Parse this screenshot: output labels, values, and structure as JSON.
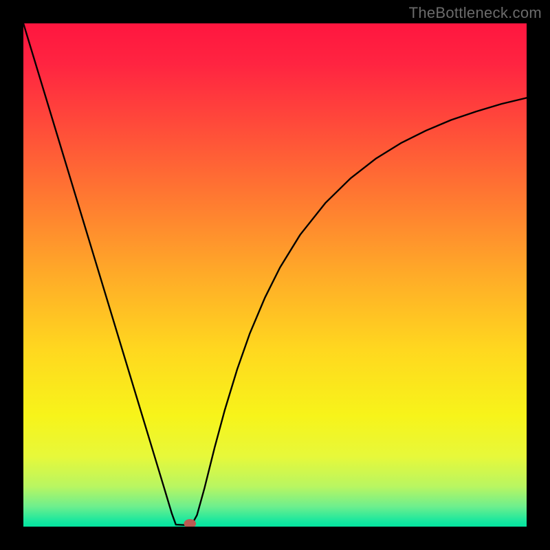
{
  "watermark": "TheBottleneck.com",
  "chart_data": {
    "type": "line",
    "title": "",
    "xlabel": "",
    "ylabel": "",
    "xlim": [
      0,
      100
    ],
    "ylim": [
      0,
      100
    ],
    "grid": false,
    "legend": false,
    "background": {
      "type": "vertical-gradient",
      "stops": [
        {
          "offset": 0.0,
          "color": "#ff163f"
        },
        {
          "offset": 0.08,
          "color": "#ff2441"
        },
        {
          "offset": 0.2,
          "color": "#ff4a3a"
        },
        {
          "offset": 0.35,
          "color": "#ff7a31"
        },
        {
          "offset": 0.5,
          "color": "#ffab28"
        },
        {
          "offset": 0.65,
          "color": "#ffd81f"
        },
        {
          "offset": 0.78,
          "color": "#f7f41a"
        },
        {
          "offset": 0.86,
          "color": "#e7f83a"
        },
        {
          "offset": 0.92,
          "color": "#b9f661"
        },
        {
          "offset": 0.96,
          "color": "#6eef8d"
        },
        {
          "offset": 0.99,
          "color": "#15e79f"
        },
        {
          "offset": 1.0,
          "color": "#04e39f"
        }
      ]
    },
    "series": [
      {
        "name": "left-branch",
        "stroke": "#000000",
        "points": [
          {
            "x": 0.0,
            "y": 100.0
          },
          {
            "x": 2.0,
            "y": 93.4
          },
          {
            "x": 5.0,
            "y": 83.5
          },
          {
            "x": 8.0,
            "y": 73.6
          },
          {
            "x": 11.0,
            "y": 63.7
          },
          {
            "x": 14.0,
            "y": 53.8
          },
          {
            "x": 17.0,
            "y": 43.9
          },
          {
            "x": 20.0,
            "y": 34.0
          },
          {
            "x": 23.0,
            "y": 24.1
          },
          {
            "x": 26.0,
            "y": 14.2
          },
          {
            "x": 28.0,
            "y": 7.6
          },
          {
            "x": 29.5,
            "y": 2.6
          },
          {
            "x": 30.3,
            "y": 0.4
          }
        ]
      },
      {
        "name": "valley-floor",
        "stroke": "#000000",
        "points": [
          {
            "x": 30.3,
            "y": 0.4
          },
          {
            "x": 32.4,
            "y": 0.3
          },
          {
            "x": 33.4,
            "y": 0.3
          }
        ]
      },
      {
        "name": "right-branch",
        "stroke": "#000000",
        "points": [
          {
            "x": 33.4,
            "y": 0.3
          },
          {
            "x": 34.5,
            "y": 2.3
          },
          {
            "x": 36.0,
            "y": 7.7
          },
          {
            "x": 38.0,
            "y": 15.7
          },
          {
            "x": 40.0,
            "y": 23.1
          },
          {
            "x": 42.5,
            "y": 31.3
          },
          {
            "x": 45.0,
            "y": 38.4
          },
          {
            "x": 48.0,
            "y": 45.5
          },
          {
            "x": 51.0,
            "y": 51.5
          },
          {
            "x": 55.0,
            "y": 58.0
          },
          {
            "x": 60.0,
            "y": 64.3
          },
          {
            "x": 65.0,
            "y": 69.2
          },
          {
            "x": 70.0,
            "y": 73.1
          },
          {
            "x": 75.0,
            "y": 76.2
          },
          {
            "x": 80.0,
            "y": 78.7
          },
          {
            "x": 85.0,
            "y": 80.8
          },
          {
            "x": 90.0,
            "y": 82.5
          },
          {
            "x": 95.0,
            "y": 84.0
          },
          {
            "x": 100.0,
            "y": 85.2
          }
        ]
      }
    ],
    "marker": {
      "name": "valley-marker",
      "x": 33.1,
      "y": 0.6,
      "rx": 1.2,
      "ry": 0.9,
      "fill": "#bb5a52"
    }
  }
}
